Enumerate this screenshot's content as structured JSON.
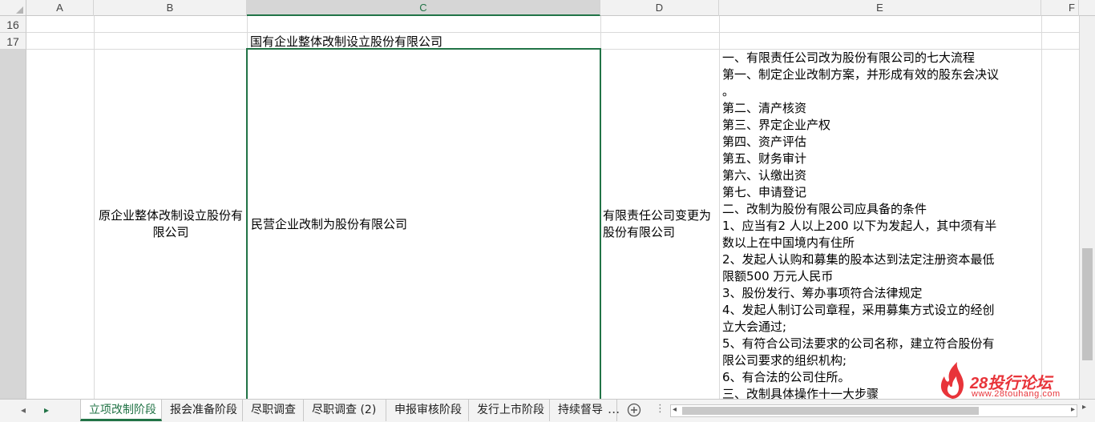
{
  "columns": [
    "A",
    "B",
    "C",
    "D",
    "E",
    "F"
  ],
  "rows": [
    "16",
    "17"
  ],
  "cells": {
    "c17": "国有企业整体改制设立股份有限公司",
    "b18": "原企业整体改制设立股份有限公司",
    "c18": "民营企业改制为股份有限公司",
    "d18": "有限责任公司变更为股份有限公司",
    "e18_lines": [
      "一、有限责任公司改为股份有限公司的七大流程",
      "第一、制定企业改制方案，并形成有效的股东会决议",
      "。",
      "第二、清产核资",
      "第三、界定企业产权",
      "第四、资产评估",
      "第五、财务审计",
      "第六、认缴出资",
      "第七、申请登记",
      "二、改制为股份有限公司应具备的条件",
      "1、应当有2 人以上200 以下为发起人，其中须有半",
      "数以上在中国境内有住所",
      "2、发起人认购和募集的股本达到法定注册资本最低",
      "限额500 万元人民币",
      "3、股份发行、筹办事项符合法律规定",
      "4、发起人制订公司章程，采用募集方式设立的经创",
      "立大会通过;",
      "5、有符合公司法要求的公司名称，建立符合股份有",
      "限公司要求的组织机构;",
      "6、有合法的公司住所。",
      "三、改制具体操作十一大步骤"
    ]
  },
  "sheet_tabs": [
    "立项改制阶段",
    "报会准备阶段",
    "尽职调查",
    "尽职调查 (2)",
    "申报审核阶段",
    "发行上市阶段",
    "持续督导"
  ],
  "active_tab": 0,
  "tab_more": "...",
  "add_sheet_icon": "plus-circle-icon",
  "watermark": {
    "brand": "28投行论坛",
    "url": "www.28touhang.com"
  },
  "colors": {
    "accent": "#217346",
    "watermark": "#e8343a"
  }
}
